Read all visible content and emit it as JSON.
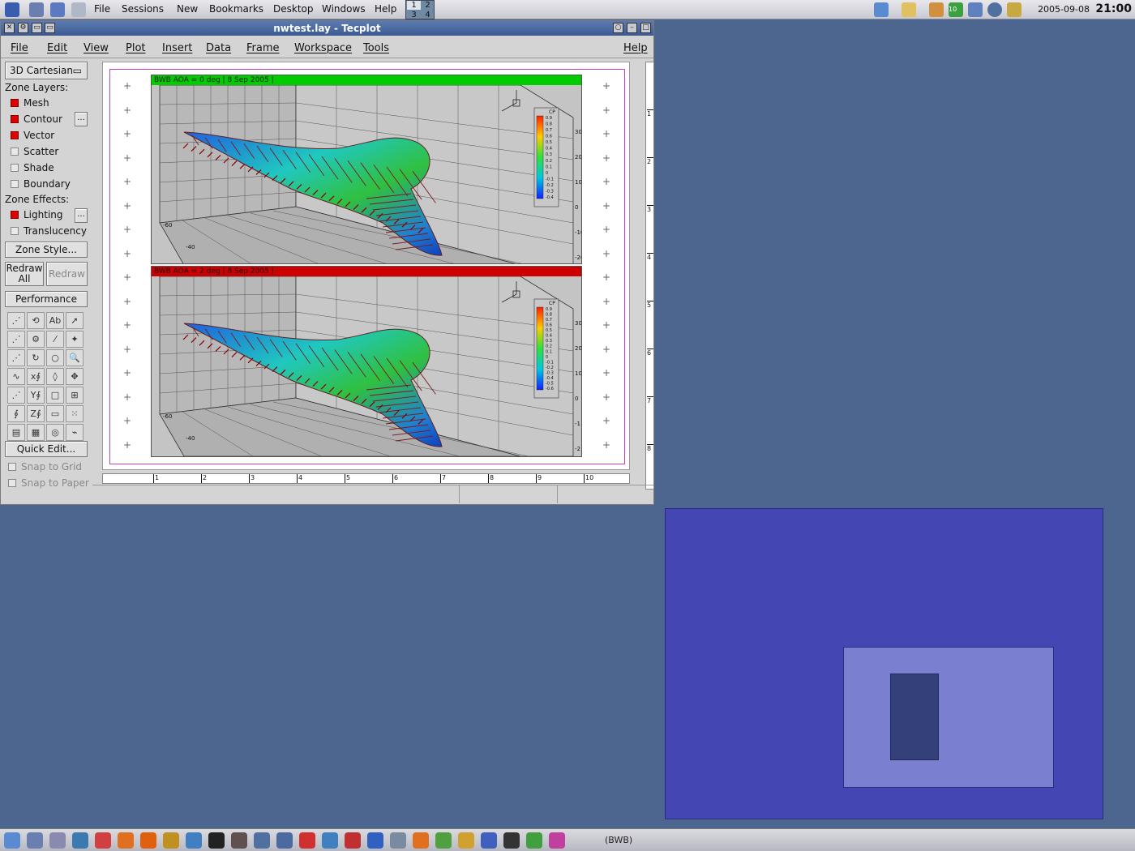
{
  "topbar": {
    "menus": [
      "File",
      "Sessions",
      "New",
      "Bookmarks",
      "Desktop",
      "Windows",
      "Help"
    ],
    "pager": [
      "1",
      "2",
      "3",
      "4"
    ],
    "date": "2005-09-08",
    "time": "21:00",
    "net_badge": "10"
  },
  "window": {
    "title": "nwtest.lay - Tecplot",
    "menus": [
      "File",
      "Edit",
      "View",
      "Plot",
      "Insert",
      "Data",
      "Frame",
      "Workspace",
      "Tools"
    ],
    "help": "Help"
  },
  "sidebar": {
    "plot_type": "3D Cartesian",
    "zone_layers_title": "Zone Layers:",
    "zone_layers": [
      {
        "label": "Mesh",
        "checked": true
      },
      {
        "label": "Contour",
        "checked": true
      },
      {
        "label": "Vector",
        "checked": true
      },
      {
        "label": "Scatter",
        "checked": false
      },
      {
        "label": "Shade",
        "checked": false
      },
      {
        "label": "Boundary",
        "checked": false
      }
    ],
    "zone_effects_title": "Zone Effects:",
    "zone_effects": [
      {
        "label": "Lighting",
        "checked": true
      },
      {
        "label": "Translucency",
        "checked": false
      }
    ],
    "zone_style": "Zone Style...",
    "redraw_all": "Redraw All",
    "redraw": "Redraw",
    "performance": "Performance",
    "quick_edit": "Quick Edit...",
    "snap_grid": "Snap to Grid",
    "snap_paper": "Snap to Paper",
    "more": "..."
  },
  "tools": [
    "⋰",
    "⟲",
    "Ab",
    "➚",
    "⋰",
    "⚙",
    "⁄",
    "✦",
    "⋰",
    "↻",
    "○",
    "🔍",
    "∿",
    "x∮",
    "◊",
    "✥",
    "⋰",
    "Y∮",
    "□",
    "⊞",
    "∮",
    "Z∮",
    "▭",
    "⁙",
    "▤",
    "▦",
    "◎",
    "⌁"
  ],
  "plots": [
    {
      "header": "BWB AOA = 0 deg | 8 Sep 2005 |",
      "header_color": "#00cc00",
      "x_ticks": [
        "-60",
        "-40"
      ],
      "z_ticks": [
        "30",
        "20",
        "10",
        "0",
        "-10",
        "-20"
      ],
      "legend_title": "CP",
      "legend_levels": [
        "0.9",
        "0.8",
        "0.7",
        "0.6",
        "0.5",
        "0.4",
        "0.3",
        "0.2",
        "0.1",
        "0",
        "-0.1",
        "-0.2",
        "-0.3",
        "-0.4"
      ]
    },
    {
      "header": "BWB AOA = 2 deg | 8 Sep 2005 |",
      "header_color": "#cc0000",
      "x_ticks": [
        "-60",
        "-40"
      ],
      "z_ticks": [
        "30",
        "20",
        "10",
        "0",
        "-1",
        "-2"
      ],
      "legend_title": "CP",
      "legend_levels": [
        "0.9",
        "0.8",
        "0.7",
        "0.6",
        "0.5",
        "0.4",
        "0.3",
        "0.2",
        "0.1",
        "0",
        "-0.1",
        "-0.2",
        "-0.3",
        "-0.4",
        "-0.5",
        "-0.6"
      ]
    }
  ],
  "h_ruler": [
    "1",
    "2",
    "3",
    "4",
    "5",
    "6",
    "7",
    "8",
    "9",
    "10"
  ],
  "v_ruler": [
    "1",
    "2",
    "3",
    "4",
    "5",
    "6",
    "7",
    "8"
  ],
  "taskbar_user": "(BWB)"
}
